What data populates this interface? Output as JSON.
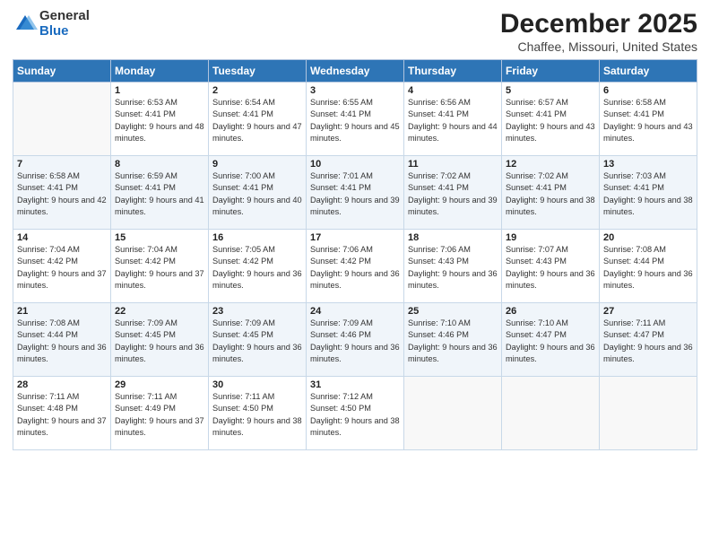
{
  "logo": {
    "general": "General",
    "blue": "Blue"
  },
  "title": "December 2025",
  "location": "Chaffee, Missouri, United States",
  "days_of_week": [
    "Sunday",
    "Monday",
    "Tuesday",
    "Wednesday",
    "Thursday",
    "Friday",
    "Saturday"
  ],
  "weeks": [
    [
      {
        "day": "",
        "sunrise": "",
        "sunset": "",
        "daylight": ""
      },
      {
        "day": "1",
        "sunrise": "Sunrise: 6:53 AM",
        "sunset": "Sunset: 4:41 PM",
        "daylight": "Daylight: 9 hours and 48 minutes."
      },
      {
        "day": "2",
        "sunrise": "Sunrise: 6:54 AM",
        "sunset": "Sunset: 4:41 PM",
        "daylight": "Daylight: 9 hours and 47 minutes."
      },
      {
        "day": "3",
        "sunrise": "Sunrise: 6:55 AM",
        "sunset": "Sunset: 4:41 PM",
        "daylight": "Daylight: 9 hours and 45 minutes."
      },
      {
        "day": "4",
        "sunrise": "Sunrise: 6:56 AM",
        "sunset": "Sunset: 4:41 PM",
        "daylight": "Daylight: 9 hours and 44 minutes."
      },
      {
        "day": "5",
        "sunrise": "Sunrise: 6:57 AM",
        "sunset": "Sunset: 4:41 PM",
        "daylight": "Daylight: 9 hours and 43 minutes."
      },
      {
        "day": "6",
        "sunrise": "Sunrise: 6:58 AM",
        "sunset": "Sunset: 4:41 PM",
        "daylight": "Daylight: 9 hours and 43 minutes."
      }
    ],
    [
      {
        "day": "7",
        "sunrise": "Sunrise: 6:58 AM",
        "sunset": "Sunset: 4:41 PM",
        "daylight": "Daylight: 9 hours and 42 minutes."
      },
      {
        "day": "8",
        "sunrise": "Sunrise: 6:59 AM",
        "sunset": "Sunset: 4:41 PM",
        "daylight": "Daylight: 9 hours and 41 minutes."
      },
      {
        "day": "9",
        "sunrise": "Sunrise: 7:00 AM",
        "sunset": "Sunset: 4:41 PM",
        "daylight": "Daylight: 9 hours and 40 minutes."
      },
      {
        "day": "10",
        "sunrise": "Sunrise: 7:01 AM",
        "sunset": "Sunset: 4:41 PM",
        "daylight": "Daylight: 9 hours and 39 minutes."
      },
      {
        "day": "11",
        "sunrise": "Sunrise: 7:02 AM",
        "sunset": "Sunset: 4:41 PM",
        "daylight": "Daylight: 9 hours and 39 minutes."
      },
      {
        "day": "12",
        "sunrise": "Sunrise: 7:02 AM",
        "sunset": "Sunset: 4:41 PM",
        "daylight": "Daylight: 9 hours and 38 minutes."
      },
      {
        "day": "13",
        "sunrise": "Sunrise: 7:03 AM",
        "sunset": "Sunset: 4:41 PM",
        "daylight": "Daylight: 9 hours and 38 minutes."
      }
    ],
    [
      {
        "day": "14",
        "sunrise": "Sunrise: 7:04 AM",
        "sunset": "Sunset: 4:42 PM",
        "daylight": "Daylight: 9 hours and 37 minutes."
      },
      {
        "day": "15",
        "sunrise": "Sunrise: 7:04 AM",
        "sunset": "Sunset: 4:42 PM",
        "daylight": "Daylight: 9 hours and 37 minutes."
      },
      {
        "day": "16",
        "sunrise": "Sunrise: 7:05 AM",
        "sunset": "Sunset: 4:42 PM",
        "daylight": "Daylight: 9 hours and 36 minutes."
      },
      {
        "day": "17",
        "sunrise": "Sunrise: 7:06 AM",
        "sunset": "Sunset: 4:42 PM",
        "daylight": "Daylight: 9 hours and 36 minutes."
      },
      {
        "day": "18",
        "sunrise": "Sunrise: 7:06 AM",
        "sunset": "Sunset: 4:43 PM",
        "daylight": "Daylight: 9 hours and 36 minutes."
      },
      {
        "day": "19",
        "sunrise": "Sunrise: 7:07 AM",
        "sunset": "Sunset: 4:43 PM",
        "daylight": "Daylight: 9 hours and 36 minutes."
      },
      {
        "day": "20",
        "sunrise": "Sunrise: 7:08 AM",
        "sunset": "Sunset: 4:44 PM",
        "daylight": "Daylight: 9 hours and 36 minutes."
      }
    ],
    [
      {
        "day": "21",
        "sunrise": "Sunrise: 7:08 AM",
        "sunset": "Sunset: 4:44 PM",
        "daylight": "Daylight: 9 hours and 36 minutes."
      },
      {
        "day": "22",
        "sunrise": "Sunrise: 7:09 AM",
        "sunset": "Sunset: 4:45 PM",
        "daylight": "Daylight: 9 hours and 36 minutes."
      },
      {
        "day": "23",
        "sunrise": "Sunrise: 7:09 AM",
        "sunset": "Sunset: 4:45 PM",
        "daylight": "Daylight: 9 hours and 36 minutes."
      },
      {
        "day": "24",
        "sunrise": "Sunrise: 7:09 AM",
        "sunset": "Sunset: 4:46 PM",
        "daylight": "Daylight: 9 hours and 36 minutes."
      },
      {
        "day": "25",
        "sunrise": "Sunrise: 7:10 AM",
        "sunset": "Sunset: 4:46 PM",
        "daylight": "Daylight: 9 hours and 36 minutes."
      },
      {
        "day": "26",
        "sunrise": "Sunrise: 7:10 AM",
        "sunset": "Sunset: 4:47 PM",
        "daylight": "Daylight: 9 hours and 36 minutes."
      },
      {
        "day": "27",
        "sunrise": "Sunrise: 7:11 AM",
        "sunset": "Sunset: 4:47 PM",
        "daylight": "Daylight: 9 hours and 36 minutes."
      }
    ],
    [
      {
        "day": "28",
        "sunrise": "Sunrise: 7:11 AM",
        "sunset": "Sunset: 4:48 PM",
        "daylight": "Daylight: 9 hours and 37 minutes."
      },
      {
        "day": "29",
        "sunrise": "Sunrise: 7:11 AM",
        "sunset": "Sunset: 4:49 PM",
        "daylight": "Daylight: 9 hours and 37 minutes."
      },
      {
        "day": "30",
        "sunrise": "Sunrise: 7:11 AM",
        "sunset": "Sunset: 4:50 PM",
        "daylight": "Daylight: 9 hours and 38 minutes."
      },
      {
        "day": "31",
        "sunrise": "Sunrise: 7:12 AM",
        "sunset": "Sunset: 4:50 PM",
        "daylight": "Daylight: 9 hours and 38 minutes."
      },
      {
        "day": "",
        "sunrise": "",
        "sunset": "",
        "daylight": ""
      },
      {
        "day": "",
        "sunrise": "",
        "sunset": "",
        "daylight": ""
      },
      {
        "day": "",
        "sunrise": "",
        "sunset": "",
        "daylight": ""
      }
    ]
  ]
}
